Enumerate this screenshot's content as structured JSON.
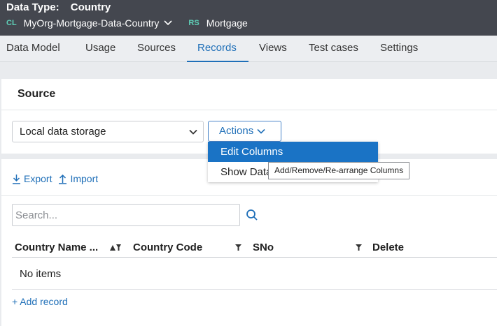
{
  "header": {
    "data_type_label": "Data Type:",
    "data_type_value": "Country",
    "class_tag": "CL",
    "class_name": "MyOrg-Mortgage-Data-Country",
    "ruleset_tag": "RS",
    "ruleset_name": "Mortgage"
  },
  "tabs": [
    {
      "label": "Data Model"
    },
    {
      "label": "Usage"
    },
    {
      "label": "Sources"
    },
    {
      "label": "Records",
      "active": true
    },
    {
      "label": "Views"
    },
    {
      "label": "Test cases"
    },
    {
      "label": "Settings"
    }
  ],
  "source": {
    "title": "Source",
    "selected_value": "Local data storage",
    "actions_label": "Actions"
  },
  "menu": {
    "items": [
      {
        "label": "Edit Columns",
        "highlighted": true
      },
      {
        "label": "Show Data"
      }
    ],
    "tooltip": "Add/Remove/Re-arrange Columns"
  },
  "toolbar": {
    "export_label": "Export",
    "import_label": "Import"
  },
  "search": {
    "placeholder": "Search..."
  },
  "table": {
    "columns": [
      {
        "label": "Country Name ..."
      },
      {
        "label": "Country Code"
      },
      {
        "label": "SNo"
      },
      {
        "label": "Delete"
      }
    ],
    "empty_text": "No items"
  },
  "add_record_label": "+ Add record",
  "colors": {
    "header_bg": "#44474f",
    "accent": "#1f6fb8",
    "tag_teal": "#5fd0b8",
    "menu_highlight": "#1a73c5"
  }
}
